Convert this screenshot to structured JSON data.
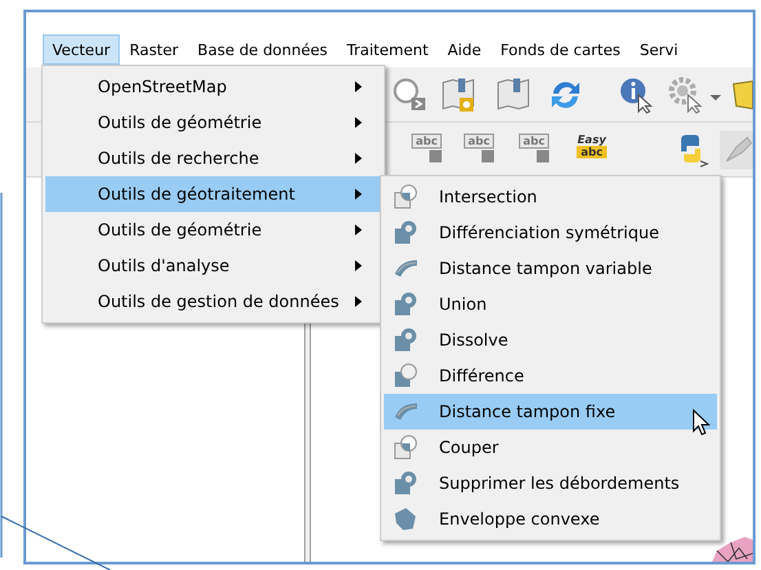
{
  "menubar": [
    {
      "label": "Vecteur",
      "selected": true
    },
    {
      "label": "Raster",
      "selected": false
    },
    {
      "label": "Base de données",
      "selected": false
    },
    {
      "label": "Traitement",
      "selected": false
    },
    {
      "label": "Aide",
      "selected": false
    },
    {
      "label": "Fonds de cartes",
      "selected": false
    },
    {
      "label": "Servi",
      "selected": false
    }
  ],
  "toolbar_labels": [
    {
      "kind": "label",
      "text": "abc"
    },
    {
      "kind": "label",
      "text": "abc"
    },
    {
      "kind": "label",
      "text": "abc"
    },
    {
      "kind": "easy",
      "text": "Easy",
      "subtext": "abc"
    }
  ],
  "vector_menu": [
    {
      "label": "OpenStreetMap",
      "selected": false
    },
    {
      "label": "Outils de géométrie",
      "selected": false
    },
    {
      "label": "Outils de recherche",
      "selected": false
    },
    {
      "label": "Outils de géotraitement",
      "selected": true
    },
    {
      "label": "Outils de géométrie",
      "selected": false
    },
    {
      "label": "Outils d'analyse",
      "selected": false
    },
    {
      "label": "Outils de gestion de données",
      "selected": false
    }
  ],
  "geoprocessing_menu": [
    {
      "label": "Intersection",
      "kind": "outline",
      "selected": false
    },
    {
      "label": "Différenciation symétrique",
      "kind": "filled",
      "selected": false
    },
    {
      "label": "Distance tampon variable",
      "kind": "buffer",
      "selected": false
    },
    {
      "label": "Union",
      "kind": "filled",
      "selected": false
    },
    {
      "label": "Dissolve",
      "kind": "filled",
      "selected": false
    },
    {
      "label": "Différence",
      "kind": "cutout",
      "selected": false
    },
    {
      "label": "Distance tampon fixe",
      "kind": "buffer",
      "selected": true
    },
    {
      "label": "Couper",
      "kind": "outline",
      "selected": false
    },
    {
      "label": "Supprimer les débordements",
      "kind": "filled",
      "selected": false
    },
    {
      "label": "Enveloppe convexe",
      "kind": "hull",
      "selected": false
    }
  ]
}
